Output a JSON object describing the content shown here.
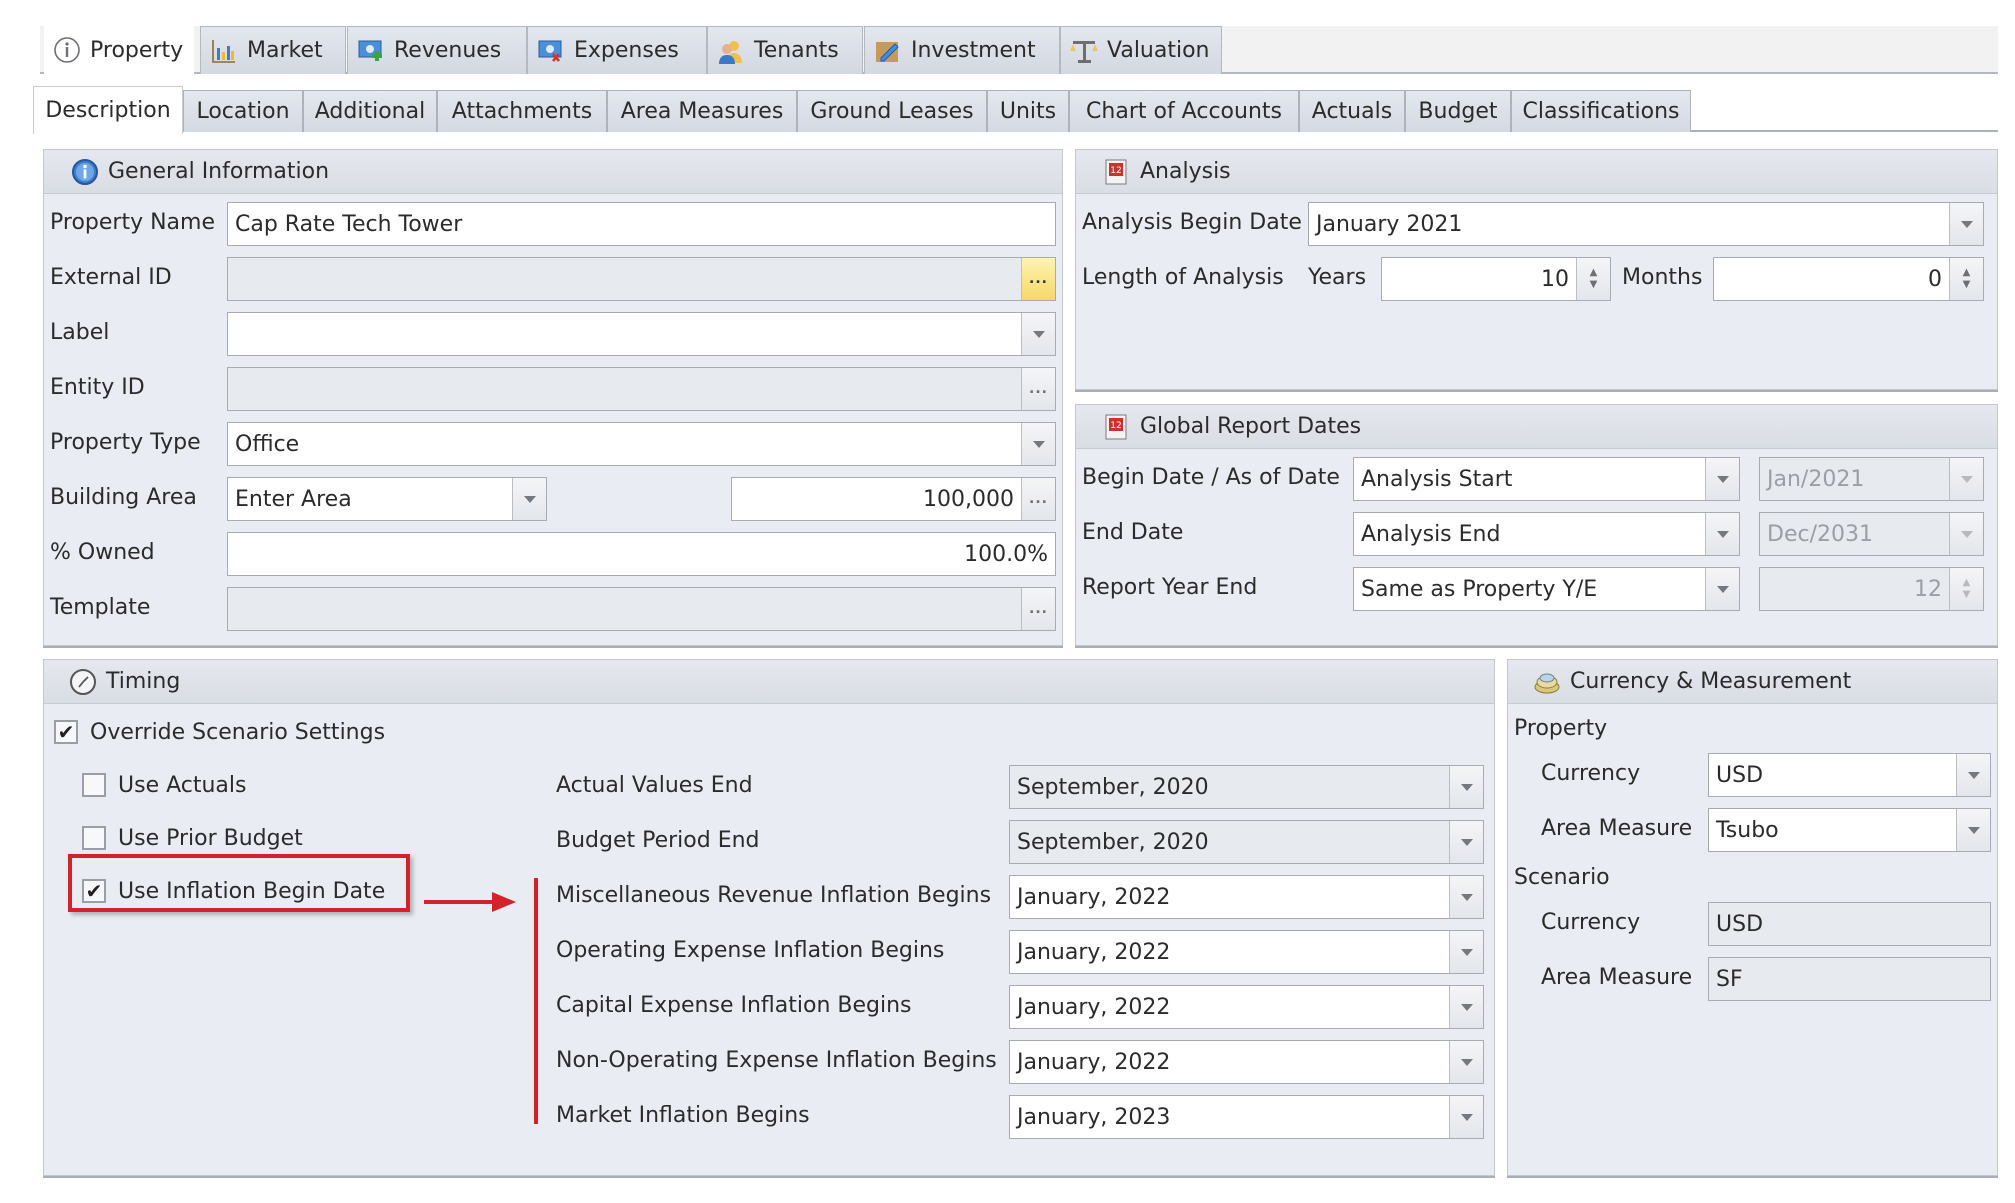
{
  "main_tabs": [
    {
      "label": "Property",
      "icon": "info-icon",
      "active": true
    },
    {
      "label": "Market",
      "icon": "chart-icon",
      "active": false
    },
    {
      "label": "Revenues",
      "icon": "revenues-icon",
      "active": false
    },
    {
      "label": "Expenses",
      "icon": "expenses-icon",
      "active": false
    },
    {
      "label": "Tenants",
      "icon": "tenants-icon",
      "active": false
    },
    {
      "label": "Investment",
      "icon": "investment-icon",
      "active": false
    },
    {
      "label": "Valuation",
      "icon": "scale-icon",
      "active": false
    }
  ],
  "sub_tabs": [
    {
      "label": "Description",
      "active": true
    },
    {
      "label": "Location"
    },
    {
      "label": "Additional"
    },
    {
      "label": "Attachments"
    },
    {
      "label": "Area Measures"
    },
    {
      "label": "Ground Leases"
    },
    {
      "label": "Units"
    },
    {
      "label": "Chart of Accounts"
    },
    {
      "label": "Actuals"
    },
    {
      "label": "Budget"
    },
    {
      "label": "Classifications"
    }
  ],
  "general": {
    "title": "General Information",
    "property_name": {
      "label": "Property Name",
      "value": "Cap Rate Tech Tower"
    },
    "external_id": {
      "label": "External ID",
      "value": "",
      "button": "..."
    },
    "label_field": {
      "label": "Label",
      "value": ""
    },
    "entity_id": {
      "label": "Entity ID",
      "value": "",
      "button": "..."
    },
    "property_type": {
      "label": "Property Type",
      "value": "Office"
    },
    "building_area": {
      "label": "Building Area",
      "mode": "Enter Area",
      "value": "100,000",
      "button": "..."
    },
    "owned": {
      "label": "% Owned",
      "value": "100.0%"
    },
    "template": {
      "label": "Template",
      "value": "",
      "button": "..."
    }
  },
  "analysis": {
    "title": "Analysis",
    "begin_date": {
      "label": "Analysis Begin Date",
      "value": "January 2021"
    },
    "length_label": "Length of Analysis",
    "years_label": "Years",
    "years": "10",
    "months_label": "Months",
    "months": "0"
  },
  "report_dates": {
    "title": "Global Report Dates",
    "begin": {
      "label": "Begin Date / As of Date",
      "value": "Analysis Start",
      "date": "Jan/2021"
    },
    "end": {
      "label": "End Date",
      "value": "Analysis End",
      "date": "Dec/2031"
    },
    "year_end": {
      "label": "Report Year End",
      "value": "Same as Property Y/E",
      "month": "12"
    }
  },
  "timing": {
    "title": "Timing",
    "override": {
      "label": "Override Scenario Settings",
      "checked": true
    },
    "use_actuals": {
      "label": "Use Actuals",
      "checked": false
    },
    "use_prior_budget": {
      "label": "Use Prior Budget",
      "checked": false
    },
    "use_inflation": {
      "label": "Use Inflation Begin Date",
      "checked": true
    },
    "check_mark": "✔",
    "rows": [
      {
        "label": "Actual Values End",
        "value": "September, 2020",
        "enabled": false
      },
      {
        "label": "Budget Period End",
        "value": "September, 2020",
        "enabled": false
      },
      {
        "label": "Miscellaneous Revenue Inflation Begins",
        "value": "January, 2022",
        "enabled": true
      },
      {
        "label": "Operating Expense Inflation Begins",
        "value": "January, 2022",
        "enabled": true
      },
      {
        "label": "Capital Expense Inflation Begins",
        "value": "January, 2022",
        "enabled": true
      },
      {
        "label": "Non-Operating Expense Inflation Begins",
        "value": "January, 2022",
        "enabled": true
      },
      {
        "label": "Market Inflation Begins",
        "value": "January, 2023",
        "enabled": true
      }
    ]
  },
  "currency": {
    "title": "Currency & Measurement",
    "property_heading": "Property",
    "property_currency": {
      "label": "Currency",
      "value": "USD"
    },
    "property_area": {
      "label": "Area Measure",
      "value": "Tsubo"
    },
    "scenario_heading": "Scenario",
    "scenario_currency": {
      "label": "Currency",
      "value": "USD"
    },
    "scenario_area": {
      "label": "Area Measure",
      "value": "SF"
    }
  },
  "colors": {
    "annotation_red": "#d3222a",
    "panel_bg": "#e9edf3",
    "highlight_button": "#f6d86a"
  }
}
